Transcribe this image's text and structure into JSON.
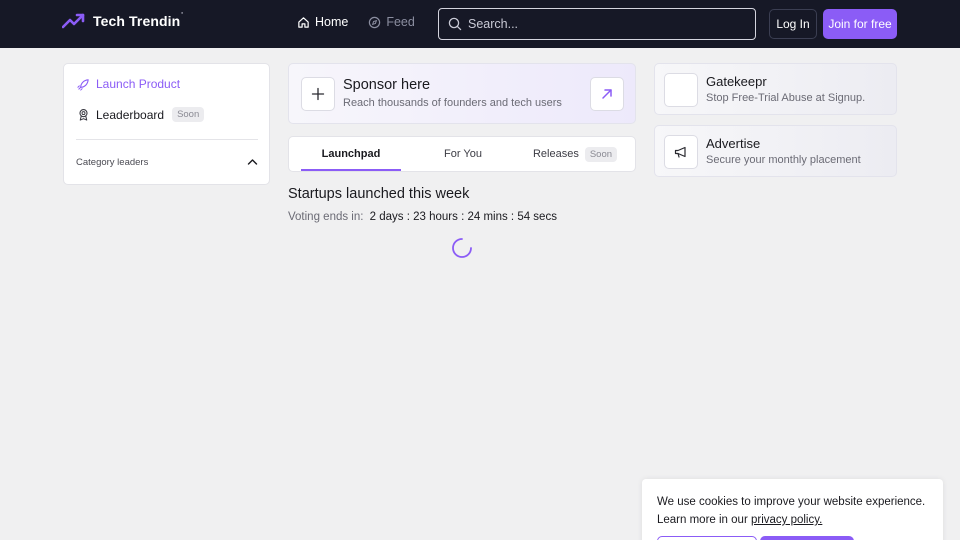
{
  "header": {
    "brand": "Tech Trendin",
    "brand_mark": "'",
    "nav": [
      {
        "label": "Home",
        "active": true
      },
      {
        "label": "Feed",
        "active": false
      }
    ],
    "search_placeholder": "Search...",
    "login_label": "Log In",
    "join_label": "Join for free"
  },
  "sidebar": {
    "launch_label": "Launch Product",
    "leaderboard_label": "Leaderboard",
    "leaderboard_badge": "Soon",
    "category_label": "Category leaders"
  },
  "sponsor": {
    "title": "Sponsor here",
    "subtitle": "Reach thousands of founders and tech users"
  },
  "tabs": [
    {
      "label": "Launchpad",
      "active": true
    },
    {
      "label": "For You",
      "active": false
    },
    {
      "label": "Releases",
      "active": false,
      "badge": "Soon"
    }
  ],
  "main": {
    "section_title": "Startups launched this week",
    "voting_label": "Voting ends in:",
    "voting_timer": "2 days : 23 hours : 24 mins : 54 secs"
  },
  "right_cards": [
    {
      "title": "Gatekeepr",
      "subtitle": "Stop Free-Trial Abuse at Signup."
    },
    {
      "title": "Advertise",
      "subtitle": "Secure your monthly placement"
    }
  ],
  "cookie": {
    "text_line1": "We use cookies to improve your website experience.",
    "text_line2_prefix": "Learn more in our ",
    "link_label": "privacy policy."
  },
  "colors": {
    "header_bg": "#161826",
    "accent": "#8b5cf6",
    "page_bg": "#f0f0f1"
  }
}
